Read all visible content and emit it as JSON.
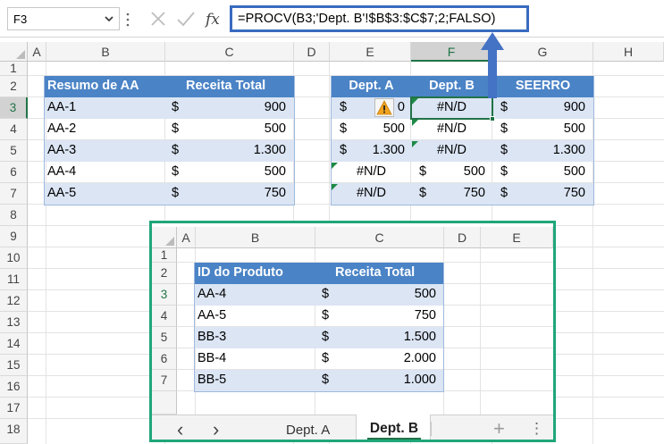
{
  "name_box": {
    "value": "F3"
  },
  "formula_bar": {
    "formula": "=PROCV(B3;'Dept. B'!$B$3:$C$7;2;FALSO)"
  },
  "columns": [
    "A",
    "B",
    "C",
    "D",
    "E",
    "F",
    "G",
    "H"
  ],
  "rows": [
    "1",
    "2",
    "3",
    "4",
    "5",
    "6",
    "7",
    "8",
    "9",
    "10",
    "11",
    "12",
    "13",
    "14",
    "15",
    "16",
    "17",
    "18"
  ],
  "summary_table": {
    "headers": [
      "Resumo de AA",
      "Receita Total"
    ],
    "rows": [
      {
        "id": "AA-1",
        "cur": "$",
        "val": "900"
      },
      {
        "id": "AA-2",
        "cur": "$",
        "val": "500"
      },
      {
        "id": "AA-3",
        "cur": "$",
        "val": "1.300"
      },
      {
        "id": "AA-4",
        "cur": "$",
        "val": "500"
      },
      {
        "id": "AA-5",
        "cur": "$",
        "val": "750"
      }
    ]
  },
  "dept_table": {
    "headers": [
      "Dept. A",
      "Dept. B",
      "SEERRO"
    ],
    "rows": [
      {
        "a_cur": "$",
        "a_val": "0",
        "b": "#N/D",
        "s_cur": "$",
        "s_val": "900"
      },
      {
        "a_cur": "$",
        "a_val": "500",
        "b": "#N/D",
        "s_cur": "$",
        "s_val": "500"
      },
      {
        "a_cur": "$",
        "a_val": "1.300",
        "b": "#N/D",
        "s_cur": "$",
        "s_val": "1.300"
      },
      {
        "a_err": "#N/D",
        "b_cur": "$",
        "b_val": "500",
        "s_cur": "$",
        "s_val": "500"
      },
      {
        "a_err": "#N/D",
        "b_cur": "$",
        "b_val": "750",
        "s_cur": "$",
        "s_val": "750"
      }
    ]
  },
  "inset": {
    "columns": [
      "A",
      "B",
      "C",
      "D",
      "E"
    ],
    "rows": [
      "1",
      "2",
      "3",
      "4",
      "5",
      "6",
      "7"
    ],
    "table": {
      "headers": [
        "ID do Produto",
        "Receita Total"
      ],
      "rows": [
        {
          "id": "AA-4",
          "cur": "$",
          "val": "500"
        },
        {
          "id": "AA-5",
          "cur": "$",
          "val": "750"
        },
        {
          "id": "BB-3",
          "cur": "$",
          "val": "1.500"
        },
        {
          "id": "BB-4",
          "cur": "$",
          "val": "2.000"
        },
        {
          "id": "BB-5",
          "cur": "$",
          "val": "1.000"
        }
      ]
    },
    "tabs": {
      "prev_icon": "‹",
      "next_icon": "›",
      "sheet1": "Dept. A",
      "sheet2": "Dept. B",
      "add_icon": "+",
      "more_icon": "⋮"
    }
  },
  "colors": {
    "header_blue": "#4a83c6",
    "band": "#dbe5f4",
    "accent_green": "#1fa67a",
    "formula_border": "#3a6bbf"
  }
}
